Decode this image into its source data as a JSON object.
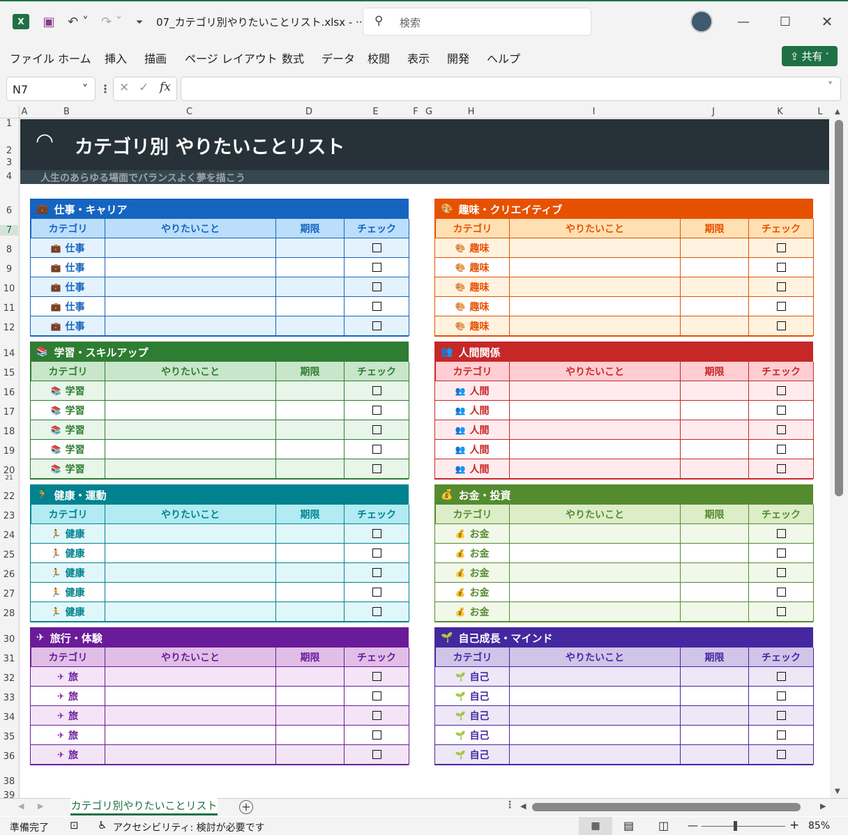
{
  "window": {
    "filename": "07_カテゴリ別やりたいことリスト.xlsx",
    "filename_more": "- ···",
    "search_placeholder": "検索"
  },
  "menu": [
    "ファイル",
    "ホーム",
    "挿入",
    "描画",
    "ページ レイアウト",
    "数式",
    "データ",
    "校閲",
    "表示",
    "開発",
    "ヘルプ"
  ],
  "share_label": "共有",
  "formula_bar": {
    "name_box": "N7",
    "fx": "fx",
    "formula": ""
  },
  "columns": [
    "A",
    "B",
    "C",
    "D",
    "E",
    "F",
    "G",
    "H",
    "I",
    "J",
    "K",
    "L"
  ],
  "rows": [
    "1",
    "2",
    "3",
    "4",
    "6",
    "7",
    "8",
    "9",
    "10",
    "11",
    "12",
    "14",
    "15",
    "16",
    "17",
    "18",
    "19",
    "20",
    "21",
    "22",
    "23",
    "24",
    "25",
    "26",
    "27",
    "28",
    "30",
    "31",
    "32",
    "33",
    "34",
    "35",
    "36",
    "38",
    "39"
  ],
  "banner": {
    "title": "カテゴリ別 やりたいことリスト",
    "subtitle": "人生のあらゆる場面でバランスよく夢を描こう"
  },
  "table_headers": {
    "category": "カテゴリ",
    "todo": "やりたいこと",
    "deadline": "期限",
    "check": "チェック"
  },
  "sections": [
    {
      "title": "仕事・キャリア",
      "cat": "仕事",
      "icon": "briefcase-icon",
      "glyph": "💼",
      "head": "#1565c0",
      "sub": "#bbdefb",
      "alt": "#e3f2fd",
      "text": "#1565c0",
      "border": "#1565c0"
    },
    {
      "title": "趣味・クリエイティブ",
      "cat": "趣味",
      "icon": "palette-icon",
      "glyph": "🎨",
      "head": "#e65100",
      "sub": "#ffe0b2",
      "alt": "#fff3e0",
      "text": "#e65100",
      "border": "#e65100"
    },
    {
      "title": "学習・スキルアップ",
      "cat": "学習",
      "icon": "books-icon",
      "glyph": "📚",
      "head": "#2e7d32",
      "sub": "#c8e6c9",
      "alt": "#e8f5e9",
      "text": "#2e7d32",
      "border": "#2e7d32"
    },
    {
      "title": "人間関係",
      "cat": "人間",
      "icon": "people-icon",
      "glyph": "👥",
      "head": "#c62828",
      "sub": "#ffcdd2",
      "alt": "#ffebee",
      "text": "#c62828",
      "border": "#c62828"
    },
    {
      "title": "健康・運動",
      "cat": "健康",
      "icon": "runner-icon",
      "glyph": "🏃",
      "head": "#00838f",
      "sub": "#b2ebf2",
      "alt": "#e0f7fa",
      "text": "#00838f",
      "border": "#00838f"
    },
    {
      "title": "お金・投資",
      "cat": "お金",
      "icon": "money-bag-icon",
      "glyph": "💰",
      "head": "#558b2f",
      "sub": "#dcedc8",
      "alt": "#f1f8e9",
      "text": "#558b2f",
      "border": "#558b2f"
    },
    {
      "title": "旅行・体験",
      "cat": "旅",
      "icon": "airplane-icon",
      "glyph": "✈",
      "head": "#6a1b9a",
      "sub": "#e1bee7",
      "alt": "#f3e5f5",
      "text": "#6a1b9a",
      "border": "#6a1b9a"
    },
    {
      "title": "自己成長・マインド",
      "cat": "自己",
      "icon": "seedling-icon",
      "glyph": "🌱",
      "head": "#4527a0",
      "sub": "#d1c4e9",
      "alt": "#ede7f6",
      "text": "#4527a0",
      "border": "#4527a0"
    }
  ],
  "sheet_tab": "カテゴリ別やりたいことリスト",
  "status": {
    "ready": "準備完了",
    "accessibility": "アクセシビリティ: 検討が必要です",
    "zoom": "85%"
  }
}
